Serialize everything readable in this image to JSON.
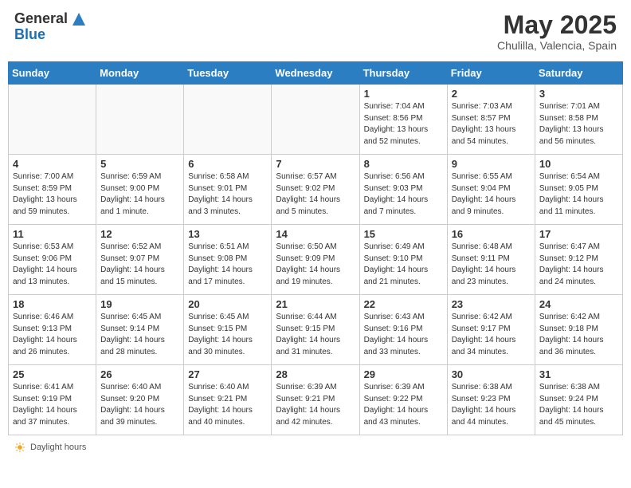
{
  "header": {
    "logo_general": "General",
    "logo_blue": "Blue",
    "month_title": "May 2025",
    "location": "Chulilla, Valencia, Spain"
  },
  "weekdays": [
    "Sunday",
    "Monday",
    "Tuesday",
    "Wednesday",
    "Thursday",
    "Friday",
    "Saturday"
  ],
  "footer_text": "Daylight hours",
  "weeks": [
    [
      {
        "day": "",
        "empty": true
      },
      {
        "day": "",
        "empty": true
      },
      {
        "day": "",
        "empty": true
      },
      {
        "day": "",
        "empty": true
      },
      {
        "day": "1",
        "sunrise": "Sunrise: 7:04 AM",
        "sunset": "Sunset: 8:56 PM",
        "daylight": "Daylight: 13 hours and 52 minutes."
      },
      {
        "day": "2",
        "sunrise": "Sunrise: 7:03 AM",
        "sunset": "Sunset: 8:57 PM",
        "daylight": "Daylight: 13 hours and 54 minutes."
      },
      {
        "day": "3",
        "sunrise": "Sunrise: 7:01 AM",
        "sunset": "Sunset: 8:58 PM",
        "daylight": "Daylight: 13 hours and 56 minutes."
      }
    ],
    [
      {
        "day": "4",
        "sunrise": "Sunrise: 7:00 AM",
        "sunset": "Sunset: 8:59 PM",
        "daylight": "Daylight: 13 hours and 59 minutes."
      },
      {
        "day": "5",
        "sunrise": "Sunrise: 6:59 AM",
        "sunset": "Sunset: 9:00 PM",
        "daylight": "Daylight: 14 hours and 1 minute."
      },
      {
        "day": "6",
        "sunrise": "Sunrise: 6:58 AM",
        "sunset": "Sunset: 9:01 PM",
        "daylight": "Daylight: 14 hours and 3 minutes."
      },
      {
        "day": "7",
        "sunrise": "Sunrise: 6:57 AM",
        "sunset": "Sunset: 9:02 PM",
        "daylight": "Daylight: 14 hours and 5 minutes."
      },
      {
        "day": "8",
        "sunrise": "Sunrise: 6:56 AM",
        "sunset": "Sunset: 9:03 PM",
        "daylight": "Daylight: 14 hours and 7 minutes."
      },
      {
        "day": "9",
        "sunrise": "Sunrise: 6:55 AM",
        "sunset": "Sunset: 9:04 PM",
        "daylight": "Daylight: 14 hours and 9 minutes."
      },
      {
        "day": "10",
        "sunrise": "Sunrise: 6:54 AM",
        "sunset": "Sunset: 9:05 PM",
        "daylight": "Daylight: 14 hours and 11 minutes."
      }
    ],
    [
      {
        "day": "11",
        "sunrise": "Sunrise: 6:53 AM",
        "sunset": "Sunset: 9:06 PM",
        "daylight": "Daylight: 14 hours and 13 minutes."
      },
      {
        "day": "12",
        "sunrise": "Sunrise: 6:52 AM",
        "sunset": "Sunset: 9:07 PM",
        "daylight": "Daylight: 14 hours and 15 minutes."
      },
      {
        "day": "13",
        "sunrise": "Sunrise: 6:51 AM",
        "sunset": "Sunset: 9:08 PM",
        "daylight": "Daylight: 14 hours and 17 minutes."
      },
      {
        "day": "14",
        "sunrise": "Sunrise: 6:50 AM",
        "sunset": "Sunset: 9:09 PM",
        "daylight": "Daylight: 14 hours and 19 minutes."
      },
      {
        "day": "15",
        "sunrise": "Sunrise: 6:49 AM",
        "sunset": "Sunset: 9:10 PM",
        "daylight": "Daylight: 14 hours and 21 minutes."
      },
      {
        "day": "16",
        "sunrise": "Sunrise: 6:48 AM",
        "sunset": "Sunset: 9:11 PM",
        "daylight": "Daylight: 14 hours and 23 minutes."
      },
      {
        "day": "17",
        "sunrise": "Sunrise: 6:47 AM",
        "sunset": "Sunset: 9:12 PM",
        "daylight": "Daylight: 14 hours and 24 minutes."
      }
    ],
    [
      {
        "day": "18",
        "sunrise": "Sunrise: 6:46 AM",
        "sunset": "Sunset: 9:13 PM",
        "daylight": "Daylight: 14 hours and 26 minutes."
      },
      {
        "day": "19",
        "sunrise": "Sunrise: 6:45 AM",
        "sunset": "Sunset: 9:14 PM",
        "daylight": "Daylight: 14 hours and 28 minutes."
      },
      {
        "day": "20",
        "sunrise": "Sunrise: 6:45 AM",
        "sunset": "Sunset: 9:15 PM",
        "daylight": "Daylight: 14 hours and 30 minutes."
      },
      {
        "day": "21",
        "sunrise": "Sunrise: 6:44 AM",
        "sunset": "Sunset: 9:15 PM",
        "daylight": "Daylight: 14 hours and 31 minutes."
      },
      {
        "day": "22",
        "sunrise": "Sunrise: 6:43 AM",
        "sunset": "Sunset: 9:16 PM",
        "daylight": "Daylight: 14 hours and 33 minutes."
      },
      {
        "day": "23",
        "sunrise": "Sunrise: 6:42 AM",
        "sunset": "Sunset: 9:17 PM",
        "daylight": "Daylight: 14 hours and 34 minutes."
      },
      {
        "day": "24",
        "sunrise": "Sunrise: 6:42 AM",
        "sunset": "Sunset: 9:18 PM",
        "daylight": "Daylight: 14 hours and 36 minutes."
      }
    ],
    [
      {
        "day": "25",
        "sunrise": "Sunrise: 6:41 AM",
        "sunset": "Sunset: 9:19 PM",
        "daylight": "Daylight: 14 hours and 37 minutes."
      },
      {
        "day": "26",
        "sunrise": "Sunrise: 6:40 AM",
        "sunset": "Sunset: 9:20 PM",
        "daylight": "Daylight: 14 hours and 39 minutes."
      },
      {
        "day": "27",
        "sunrise": "Sunrise: 6:40 AM",
        "sunset": "Sunset: 9:21 PM",
        "daylight": "Daylight: 14 hours and 40 minutes."
      },
      {
        "day": "28",
        "sunrise": "Sunrise: 6:39 AM",
        "sunset": "Sunset: 9:21 PM",
        "daylight": "Daylight: 14 hours and 42 minutes."
      },
      {
        "day": "29",
        "sunrise": "Sunrise: 6:39 AM",
        "sunset": "Sunset: 9:22 PM",
        "daylight": "Daylight: 14 hours and 43 minutes."
      },
      {
        "day": "30",
        "sunrise": "Sunrise: 6:38 AM",
        "sunset": "Sunset: 9:23 PM",
        "daylight": "Daylight: 14 hours and 44 minutes."
      },
      {
        "day": "31",
        "sunrise": "Sunrise: 6:38 AM",
        "sunset": "Sunset: 9:24 PM",
        "daylight": "Daylight: 14 hours and 45 minutes."
      }
    ]
  ]
}
